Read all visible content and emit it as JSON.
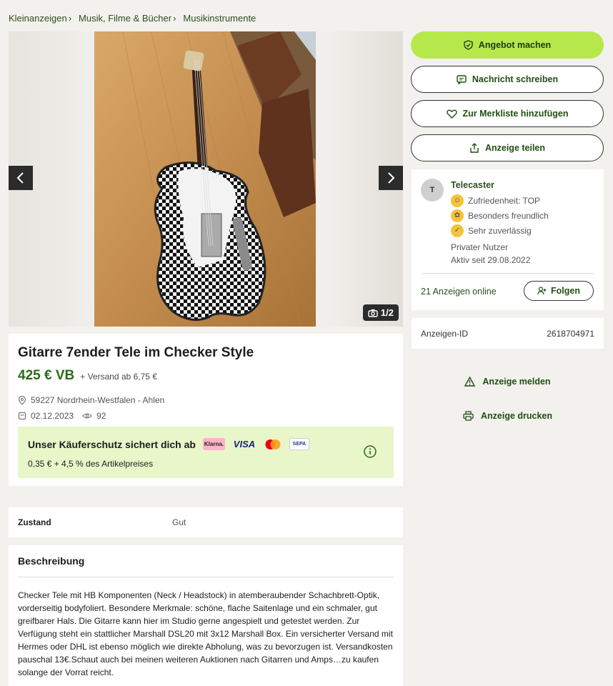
{
  "breadcrumb": [
    "Kleinanzeigen",
    "Musik, Filme & Bücher",
    "Musikinstrumente"
  ],
  "gallery": {
    "counter": "1/2"
  },
  "ad": {
    "title": "Gitarre 7ender Tele im Checker Style",
    "price": "425 € VB",
    "shipping": "+ Versand ab 6,75 €",
    "location": "59227 Nordrhein-Westfalen - Ahlen",
    "date": "02.12.2023",
    "views": "92"
  },
  "protection": {
    "headline": "Unser Käuferschutz sichert dich ab",
    "fee": "0,35 € + 4,5 % des Artikelpreises",
    "payment_methods": [
      "Klarna.",
      "VISA",
      "mastercard",
      "SEPA"
    ]
  },
  "details": {
    "label": "Zustand",
    "value": "Gut"
  },
  "description": {
    "title": "Beschreibung",
    "text": "Checker Tele mit HB Komponenten (Neck / Headstock) in atemberaubender Schachbrett-Optik, vorderseitig bodyfoliert. Besondere Merkmale: schöne, flache Saitenlage und ein schmaler, gut greifbarer Hals. Die Gitarre kann hier im Studio gerne angespielt und getestet werden. Zur Verfügung steht ein stattlicher Marshall DSL20 mit 3x12 Marshall Box. Ein versicherter Versand mit Hermes oder DHL ist ebenso möglich wie direkte Abholung, was zu bevorzugen ist. Versandkosten pauschal 13€.Schaut auch bei meinen weiteren Auktionen nach Gitarren und Amps…zu kaufen solange der Vorrat reicht."
  },
  "actions": {
    "offer": "Angebot machen",
    "message": "Nachricht schreiben",
    "watchlist": "Zur Merkliste hinzufügen",
    "share": "Anzeige teilen",
    "report": "Anzeige melden",
    "print": "Anzeige drucken"
  },
  "seller": {
    "initial": "T",
    "name": "Telecaster",
    "badges": [
      "Zufriedenheit: TOP",
      "Besonders freundlich",
      "Sehr zuverlässig"
    ],
    "user_type": "Privater Nutzer",
    "active_since": "Aktiv seit 29.08.2022",
    "ads_online": "21 Anzeigen online",
    "follow": "Folgen"
  },
  "ad_id": {
    "label": "Anzeigen-ID",
    "value": "2618704971"
  },
  "colors": {
    "accent": "#b7e84b",
    "brand_green": "#2c6a18",
    "protection_bg": "#e8f6c9"
  }
}
